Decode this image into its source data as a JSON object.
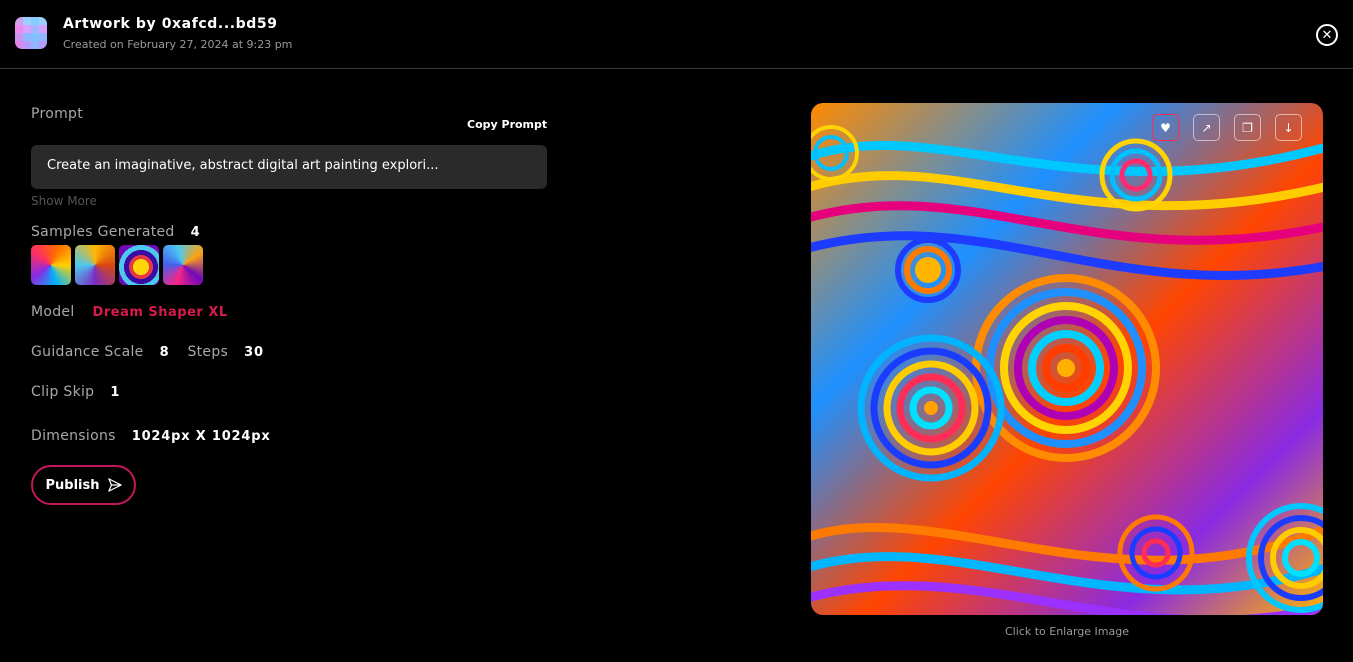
{
  "header": {
    "title": "Artwork by 0xafcd...bd59",
    "created": "Created on February 27, 2024 at 9:23 pm",
    "close_icon": "close-circle-icon"
  },
  "prompt": {
    "label": "Prompt",
    "copy_label": "Copy Prompt",
    "text": "Create an imaginative, abstract digital art painting explori...",
    "show_more": "Show More"
  },
  "samples": {
    "label": "Samples Generated",
    "count": "4"
  },
  "model": {
    "label": "Model",
    "value": "Dream Shaper XL",
    "color": "#d81b4a"
  },
  "params": {
    "guidance_label": "Guidance Scale",
    "guidance_value": "8",
    "steps_label": "Steps",
    "steps_value": "30",
    "clip_label": "Clip Skip",
    "clip_value": "1",
    "dims_label": "Dimensions",
    "dims_value": "1024px X 1024px"
  },
  "publish": {
    "label": "Publish",
    "icon": "send-icon",
    "border_color": "#c2185b"
  },
  "image": {
    "enlarge_label": "Click to Enlarge Image",
    "tools": [
      "heart-icon",
      "share-icon",
      "copy-icon",
      "download-icon"
    ]
  }
}
